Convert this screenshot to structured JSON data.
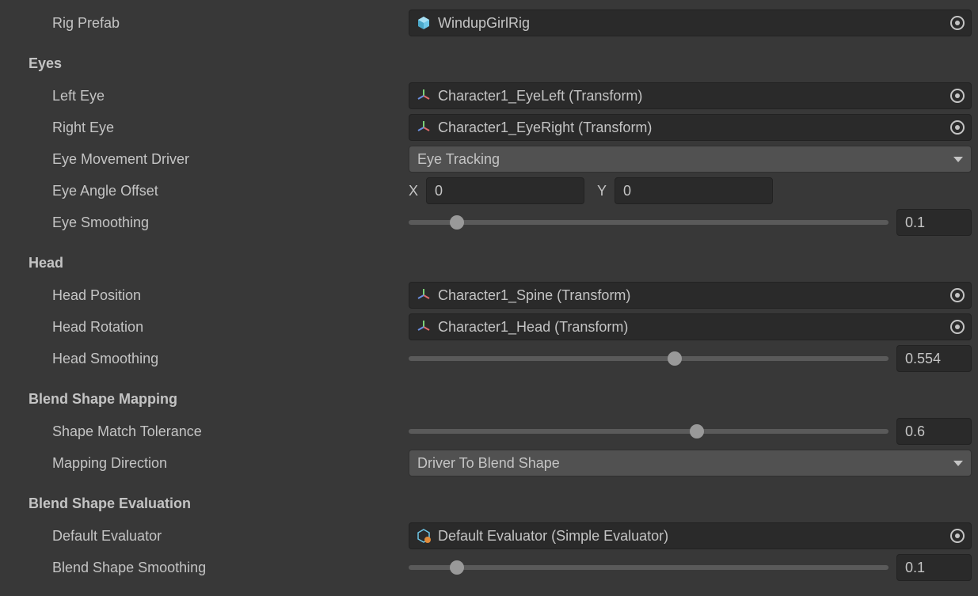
{
  "rigPrefab": {
    "label": "Rig Prefab",
    "value": "WindupGirlRig"
  },
  "sections": {
    "eyes": {
      "header": "Eyes",
      "leftEye": {
        "label": "Left Eye",
        "value": "Character1_EyeLeft (Transform)"
      },
      "rightEye": {
        "label": "Right Eye",
        "value": "Character1_EyeRight (Transform)"
      },
      "eyeMovementDriver": {
        "label": "Eye Movement Driver",
        "value": "Eye Tracking"
      },
      "eyeAngleOffset": {
        "label": "Eye Angle Offset",
        "xLabel": "X",
        "x": "0",
        "yLabel": "Y",
        "y": "0"
      },
      "eyeSmoothing": {
        "label": "Eye Smoothing",
        "value": "0.1",
        "percent": 10
      }
    },
    "head": {
      "header": "Head",
      "headPosition": {
        "label": "Head Position",
        "value": "Character1_Spine (Transform)"
      },
      "headRotation": {
        "label": "Head Rotation",
        "value": "Character1_Head (Transform)"
      },
      "headSmoothing": {
        "label": "Head Smoothing",
        "value": "0.554",
        "percent": 55.4
      }
    },
    "blendShapeMapping": {
      "header": "Blend Shape Mapping",
      "shapeMatchTolerance": {
        "label": "Shape Match Tolerance",
        "value": "0.6",
        "percent": 60
      },
      "mappingDirection": {
        "label": "Mapping Direction",
        "value": "Driver To Blend Shape"
      }
    },
    "blendShapeEvaluation": {
      "header": "Blend Shape Evaluation",
      "defaultEvaluator": {
        "label": "Default Evaluator",
        "value": "Default Evaluator (Simple Evaluator)"
      },
      "blendShapeSmoothing": {
        "label": "Blend Shape Smoothing",
        "value": "0.1",
        "percent": 10
      }
    }
  }
}
